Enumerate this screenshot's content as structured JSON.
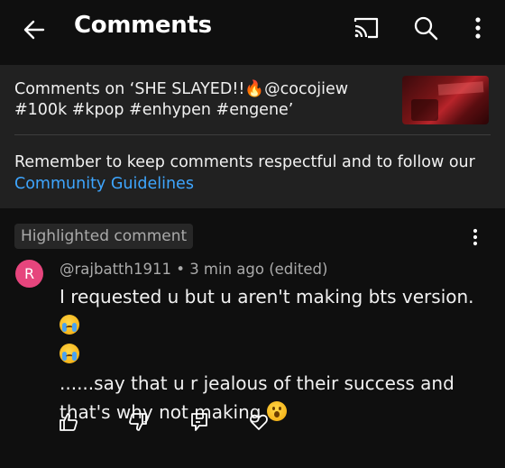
{
  "header": {
    "title": "Comments",
    "back_icon": "arrow-left-icon",
    "cast_icon": "cast-icon",
    "search_icon": "search-icon",
    "menu_icon": "more-vertical-icon"
  },
  "video_info": {
    "title": "Comments on ‘SHE SLAYED!!🔥@cocojiew #100k #kpop #enhypen #engene’",
    "guidelines_text": "Remember to keep comments respectful and to follow our ",
    "guidelines_link": "Community Guidelines"
  },
  "highlighted": {
    "badge": "Highlighted comment",
    "menu_icon": "more-vertical-icon",
    "avatar_letter": "R",
    "author": "@rajbatth1911",
    "separator": " • ",
    "time": "3 min ago (edited)",
    "line1": "I requested u but u aren't making bts version.",
    "line2": "......say that u r jealous of their success and that's why not making",
    "emoji1": "crying-face-emoji",
    "emoji2": "crying-face-emoji",
    "emoji3": "surprised-face-emoji"
  },
  "actions": {
    "like": "thumbs-up-icon",
    "dislike": "thumbs-down-icon",
    "reply": "reply-icon",
    "heart": "heart-icon"
  },
  "colors": {
    "background": "#0f0f0f",
    "panel": "#212121",
    "link": "#3ea6ff",
    "avatar": "#e6457d",
    "muted": "#aaaaaa"
  }
}
